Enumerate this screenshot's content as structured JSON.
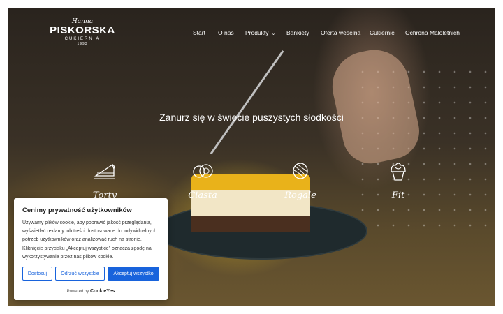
{
  "logo": {
    "script": "Hanna",
    "name": "PISKORSKA",
    "sub": "CUKIERNIA",
    "year": "1993"
  },
  "nav": {
    "items": [
      {
        "label": "Start"
      },
      {
        "label": "O nas"
      },
      {
        "label": "Produkty",
        "icon": "chevron-down-icon"
      },
      {
        "label": "Bankiety"
      },
      {
        "label": "Oferta weselna"
      },
      {
        "label": "Cukiernie"
      },
      {
        "label": "Ochrona Małoletnich"
      }
    ]
  },
  "hero": {
    "headline": "Zanurz się w świecie puszystych słodkości"
  },
  "categories": [
    {
      "label": "Torty",
      "icon": "cake-slice-icon"
    },
    {
      "label": "Ciasta",
      "icon": "pastry-icon"
    },
    {
      "label": "Rogale",
      "icon": "croissant-icon"
    },
    {
      "label": "Fit",
      "icon": "cupcake-icon"
    }
  ],
  "cookie_banner": {
    "title": "Cenimy prywatność użytkowników",
    "text": "Używamy plików cookie, aby poprawić jakość przeglądania, wyświetlać reklamy lub treści dostosowane do indywidualnych potrzeb użytkowników oraz analizować ruch na stronie. Kliknięcie przycisku „Akceptuj wszystkie” oznacza zgodę na wykorzystywanie przez nas plików cookie.",
    "buttons": {
      "customize": "Dostosuj",
      "reject": "Odrzuć wszystkie",
      "accept": "Akceptuj wszystko"
    },
    "powered_prefix": "Powered by",
    "powered_brand": "CookieYes"
  },
  "colors": {
    "accent": "#1863dc",
    "text_light": "#ffffff"
  }
}
